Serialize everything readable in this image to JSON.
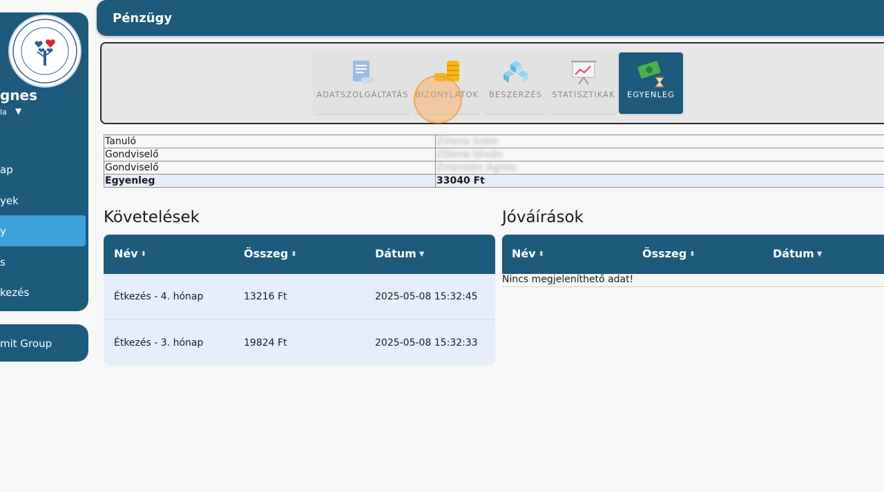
{
  "sidebar": {
    "user_name": "gnes",
    "user_sub": "la",
    "items": [
      {
        "label": "ap"
      },
      {
        "label": "yek"
      },
      {
        "label": "y"
      },
      {
        "label": "s"
      },
      {
        "label": "kezés"
      }
    ],
    "group_label": "mit Group"
  },
  "header": {
    "title": "Pénzügy"
  },
  "toolbar": {
    "buttons": [
      {
        "label": "ADATSZOLGÁLTATÁS",
        "icon": "receipt-icon"
      },
      {
        "label": "BIZONYLATOK",
        "icon": "coins-icon"
      },
      {
        "label": "BESZERZÉS",
        "icon": "cubes-icon"
      },
      {
        "label": "STATISZTIKÁK",
        "icon": "presentation-chart-icon"
      },
      {
        "label": "EGYENLEG",
        "icon": "money-hourglass-icon"
      }
    ],
    "active": "EGYENLEG"
  },
  "info": {
    "rows": [
      {
        "key": "Tanuló",
        "value": "Zölena Szalo"
      },
      {
        "key": "Gondviselő",
        "value": "Zölena István"
      },
      {
        "key": "Gondviselő",
        "value": "Zmeradin Ágnes"
      },
      {
        "key": "Egyenleg",
        "value": "33040 Ft"
      }
    ]
  },
  "kovetelesek": {
    "title": "Követelések",
    "columns": [
      "Név",
      "Összeg",
      "Dátum"
    ],
    "rows": [
      {
        "nev": "Étkezés - 4. hónap",
        "osszeg": "13216 Ft",
        "datum": "2025-05-08 15:32:45"
      },
      {
        "nev": "Étkezés - 3. hónap",
        "osszeg": "19824 Ft",
        "datum": "2025-05-08 15:32:33"
      }
    ]
  },
  "jovairasok": {
    "title": "Jóváírások",
    "columns": [
      "Név",
      "Összeg",
      "Dátum"
    ],
    "empty": "Nincs megjeleníthető adat!"
  },
  "colors": {
    "primary": "#1d5a7c",
    "accent": "#3ba2d9",
    "row_bg": "#e6eefb"
  }
}
